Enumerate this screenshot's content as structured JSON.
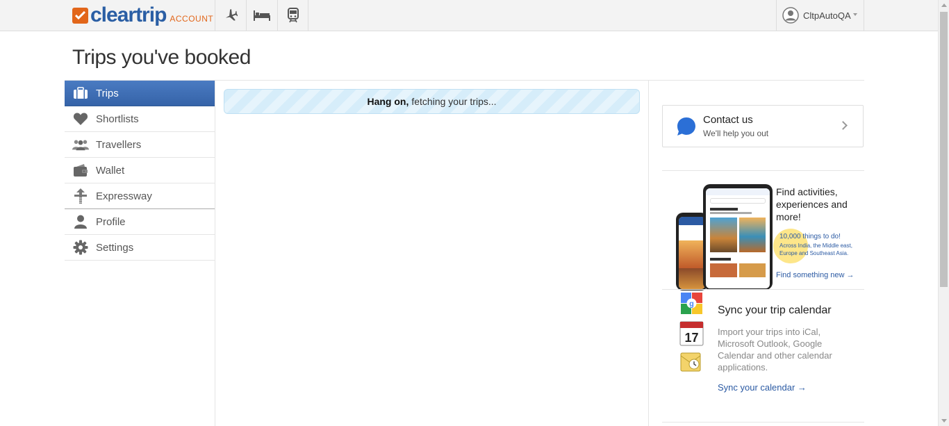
{
  "header": {
    "logo_word": "cleartrip",
    "logo_sub": "ACCOUNT",
    "nav_icons": [
      "flight-icon",
      "hotel-bed-icon",
      "train-icon"
    ],
    "user_name": "CltpAutoQA"
  },
  "page": {
    "title": "Trips you've booked"
  },
  "sidebar": {
    "items": [
      {
        "label": "Trips",
        "icon": "briefcase-icon",
        "active": true
      },
      {
        "label": "Shortlists",
        "icon": "heart-icon"
      },
      {
        "label": "Travellers",
        "icon": "people-icon"
      },
      {
        "label": "Wallet",
        "icon": "wallet-icon"
      },
      {
        "label": "Expressway",
        "icon": "expressway-icon"
      },
      {
        "label": "Profile",
        "icon": "user-icon"
      },
      {
        "label": "Settings",
        "icon": "gear-icon"
      }
    ]
  },
  "main": {
    "loading_bold": "Hang on,",
    "loading_text": "fetching your trips..."
  },
  "contact": {
    "title": "Contact us",
    "subtitle": "We'll help you out"
  },
  "promo": {
    "headline": "Find activities, experiences and more!",
    "count": "10,000",
    "count_suffix": "things to do!",
    "detail": "Across India, the Middle east, Europe and Southeast Asia.",
    "link": "Find something new →"
  },
  "sync": {
    "title": "Sync your trip calendar",
    "description": "Import your trips into iCal, Microsoft Outlook, Google Calendar and other calendar applications.",
    "link": "Sync your calendar →",
    "calendar_day": "17"
  },
  "colors": {
    "brand_orange": "#e2661a",
    "brand_blue": "#2a5ea4",
    "active_tab": "#3b6bb1",
    "link_blue": "#2b5aa3"
  }
}
